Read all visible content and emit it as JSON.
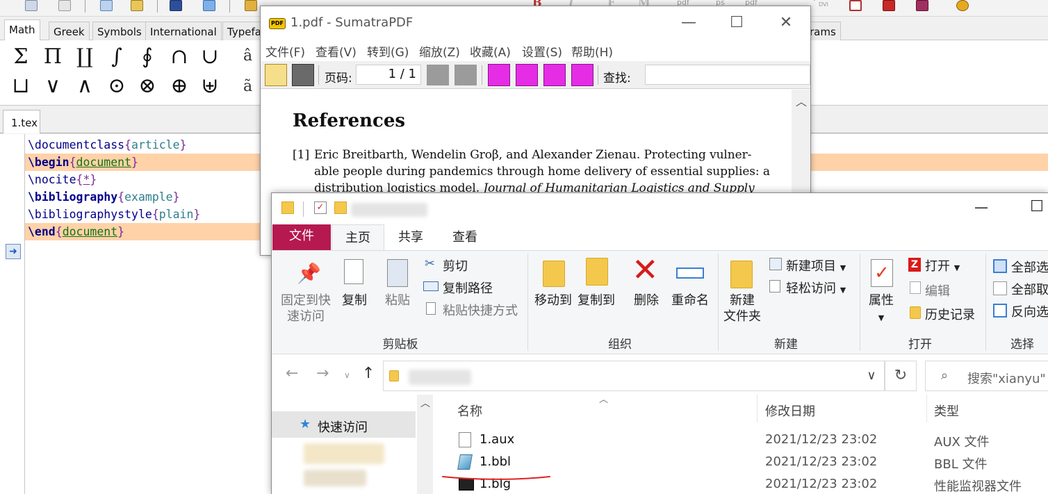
{
  "latex_editor": {
    "symbol_tabs": [
      "Math",
      "Greek",
      "Symbols",
      "International",
      "Typefa",
      "rams"
    ],
    "symbols_row1": [
      "Σ",
      "Π",
      "∐",
      "∫",
      "∮",
      "∩",
      "∪"
    ],
    "symbols_row2": [
      "⊔",
      "∨",
      "∧",
      "⊙",
      "⊗",
      "⊕",
      "⊎"
    ],
    "accents": [
      "â",
      "ã"
    ],
    "file_tab": "1.tex",
    "code_lines": [
      {
        "cmd": "\\documentclass",
        "arg": "article",
        "highlight": false
      },
      {
        "cmd": "\\begin",
        "arg": "document",
        "highlight": true
      },
      {
        "cmd": "\\nocite",
        "arg": "*",
        "highlight": false
      },
      {
        "cmd": "\\bibliography",
        "arg": "example",
        "highlight": false
      },
      {
        "cmd": "\\bibliographystyle",
        "arg": "plain",
        "highlight": false
      },
      {
        "cmd": "\\end",
        "arg": "document",
        "highlight": true
      }
    ],
    "toolbar_labels": [
      "B",
      "I",
      "F",
      "M",
      "pdf",
      "ps",
      "pdf",
      "DVI"
    ]
  },
  "sumatra": {
    "app_icon_text": "PDF",
    "title": "1.pdf - SumatraPDF",
    "menu": [
      "文件(F)",
      "查看(V)",
      "转到(G)",
      "缩放(Z)",
      "收藏(A)",
      "设置(S)",
      "帮助(H)"
    ],
    "page_label": "页码:",
    "page_value": "1 / 1",
    "find_label": "查找:",
    "document": {
      "heading": "References",
      "ref_number": "[1]",
      "line1": "Eric Breitbarth, Wendelin Groβ, and Alexander Zienau. Protecting vulner-",
      "line2": "able people during pandemics through home delivery of essential supplies: a",
      "line3_normal": "distribution logistics model.",
      "line3_italic": "Journal of Humanitarian Logistics and Supply"
    }
  },
  "explorer": {
    "tabs": [
      "文件",
      "主页",
      "共享",
      "查看"
    ],
    "clipboard": {
      "pin": "固定到快速访问",
      "copy": "复制",
      "paste": "粘贴",
      "cut": "剪切",
      "copy_path": "复制路径",
      "paste_shortcut": "粘贴快捷方式",
      "group": "剪贴板"
    },
    "organize": {
      "move_to": "移动到",
      "copy_to": "复制到",
      "delete": "删除",
      "rename": "重命名",
      "group": "组织"
    },
    "new": {
      "new_folder_l1": "新建",
      "new_folder_l2": "文件夹",
      "new_item": "新建项目",
      "easy_access": "轻松访问",
      "group": "新建"
    },
    "open": {
      "properties": "属性",
      "open": "打开",
      "edit": "编辑",
      "history": "历史记录",
      "group": "打开"
    },
    "select": {
      "select_all": "全部选",
      "select_none": "全部取",
      "invert": "反向选",
      "group": "选择"
    },
    "search_placeholder": "搜索\"xianyu\"",
    "nav": {
      "quick_access": "快速访问"
    },
    "columns": {
      "name": "名称",
      "date": "修改日期",
      "type": "类型"
    },
    "files": [
      {
        "name": "1.aux",
        "date": "2021/12/23 23:02",
        "type": "AUX 文件"
      },
      {
        "name": "1.bbl",
        "date": "2021/12/23 23:02",
        "type": "BBL 文件"
      },
      {
        "name": "1.blg",
        "date": "2021/12/23 23:02",
        "type": "性能监视器文件"
      }
    ]
  }
}
